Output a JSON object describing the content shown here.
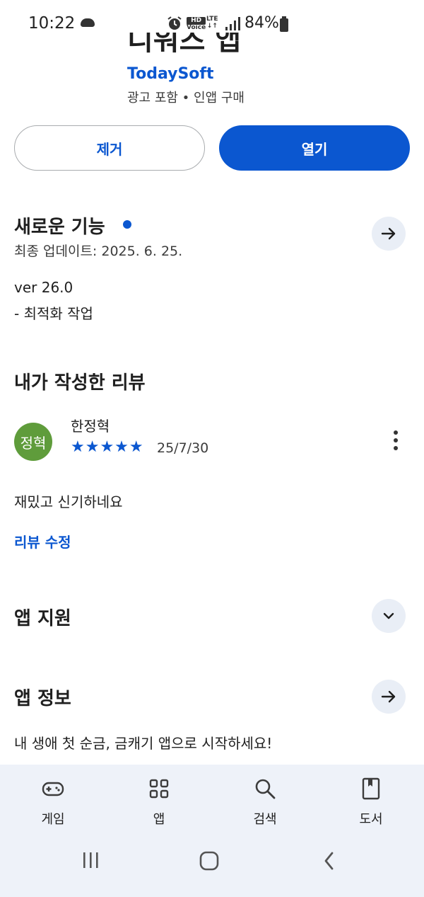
{
  "status_bar": {
    "time": "10:22",
    "hd_label_top": "HD",
    "hd_label_bottom": "Voice",
    "network": "LTE",
    "battery_percent": "84%"
  },
  "app": {
    "name": "디워즈 앱",
    "developer": "TodaySoft",
    "meta": "광고 포함 • 인앱 구매",
    "remove_button": "제거",
    "open_button": "열기"
  },
  "whats_new": {
    "title": "새로운 기능",
    "updated": "최종 업데이트: 2025. 6. 25.",
    "version": "ver 26.0",
    "note": "- 최적화 작업"
  },
  "my_review": {
    "title": "내가 작성한 리뷰",
    "avatar_text": "정혁",
    "reviewer": "한정혁",
    "rating": 5,
    "stars": "★★★★★",
    "date": "25/7/30",
    "body": "재밌고 신기하네요",
    "edit_link": "리뷰 수정"
  },
  "app_support": {
    "title": "앱 지원"
  },
  "app_info": {
    "title": "앱 정보",
    "description": "내 생애 첫 순금, 금캐기 앱으로 시작하세요!"
  },
  "bottom_nav": {
    "items": [
      {
        "label": "게임",
        "icon": "gamepad-icon"
      },
      {
        "label": "앱",
        "icon": "apps-grid-icon"
      },
      {
        "label": "검색",
        "icon": "search-icon"
      },
      {
        "label": "도서",
        "icon": "book-icon"
      }
    ]
  },
  "colors": {
    "accent": "#0b57d0",
    "avatar": "#5f9c3b",
    "nav_background": "#eef2f9",
    "circle_button": "#e9eef6"
  }
}
